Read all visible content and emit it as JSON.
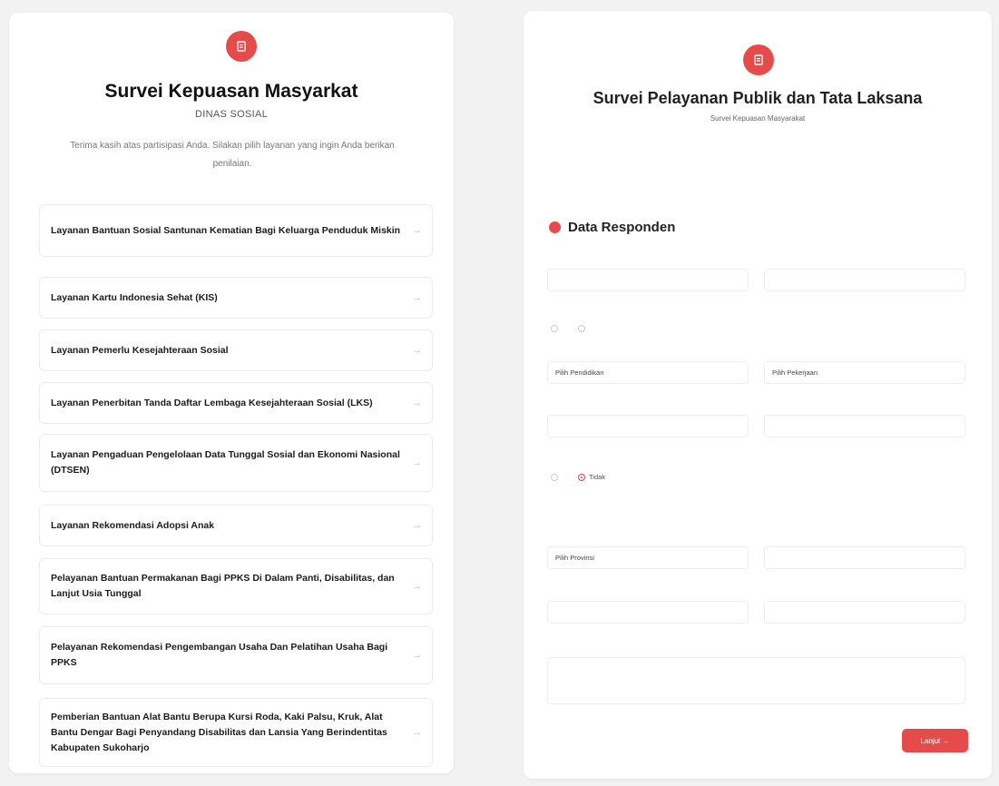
{
  "left": {
    "title": "Survei Kepuasan Masyarkat",
    "subtitle": "DINAS SOSIAL",
    "description": "Terima kasih atas partisipasi Anda. Silakan pilih layanan yang ingin Anda berikan penilaian.",
    "services": [
      "Layanan Bantuan Sosial Santunan Kematian Bagi Keluarga Penduduk Miskin",
      "Layanan Kartu Indonesia Sehat (KIS)",
      "Layanan Pemerlu Kesejahteraan Sosial",
      "Layanan Penerbitan Tanda Daftar Lembaga Kesejahteraan Sosial (LKS)",
      "Layanan Pengaduan Pengelolaan Data Tunggal Sosial dan Ekonomi Nasional (DTSEN)",
      "Layanan Rekomendasi Adopsi Anak",
      "Pelayanan Bantuan Permakanan Bagi PPKS Di Dalam Panti, Disabilitas, dan Lanjut Usia Tunggal",
      "Pelayanan Rekomendasi Pengembangan Usaha Dan Pelatihan Usaha Bagi PPKS",
      "Pemberian Bantuan Alat Bantu Berupa Kursi Roda, Kaki Palsu, Kruk, Alat Bantu Dengar Bagi Penyandang Disabilitas dan Lansia Yang Berindentitas Kabupaten Sukoharjo"
    ],
    "arrow": "→"
  },
  "right": {
    "title": "Survei Pelayanan Publik dan Tata Laksana",
    "subtitle": "Survei Kepuasan Masyarakat",
    "section": "Data Responden",
    "education_value": "Pilih Pendidikan",
    "job_value": "Pilih Pekerjaan",
    "radio_no": "Tidak",
    "province_value": "Pilih Provinsi",
    "next_label": "Lanjut →"
  },
  "colors": {
    "accent": "#e54b4b"
  },
  "icons": {
    "header_badge": "document-icon",
    "item_arrow": "arrow-right-icon"
  }
}
